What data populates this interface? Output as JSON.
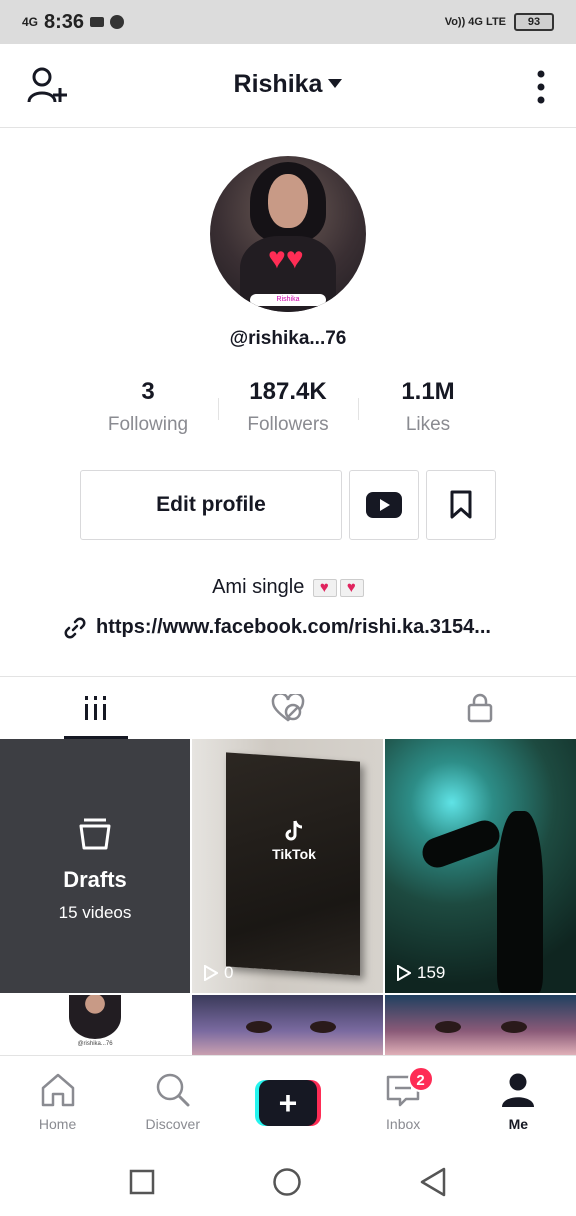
{
  "status_bar": {
    "network_left": "4G",
    "time": "8:36",
    "network_right": "Vo)) 4G LTE",
    "battery": "93"
  },
  "header": {
    "username": "Rishika"
  },
  "profile": {
    "handle": "@rishika...76",
    "avatar_caption": "Rishika",
    "stats": [
      {
        "value": "3",
        "label": "Following"
      },
      {
        "value": "187.4K",
        "label": "Followers"
      },
      {
        "value": "1.1M",
        "label": "Likes"
      }
    ],
    "edit_profile_label": "Edit profile",
    "bio": "Ami  single",
    "link": "https://www.facebook.com/rishi.ka.3154..."
  },
  "grid": {
    "drafts_title": "Drafts",
    "drafts_count": "15 videos",
    "videos": [
      {
        "overlay_text": "TikTok",
        "views": "0"
      },
      {
        "views": "159"
      }
    ],
    "mini_handle": "@rishika...76"
  },
  "bottom_nav": {
    "items": [
      {
        "label": "Home"
      },
      {
        "label": "Discover"
      },
      {
        "label": ""
      },
      {
        "label": "Inbox",
        "badge": "2"
      },
      {
        "label": "Me"
      }
    ]
  },
  "colors": {
    "accent_red": "#fe2c55",
    "accent_cyan": "#25f4ee",
    "text_dark": "#161823",
    "text_grey": "#8a8b91"
  }
}
